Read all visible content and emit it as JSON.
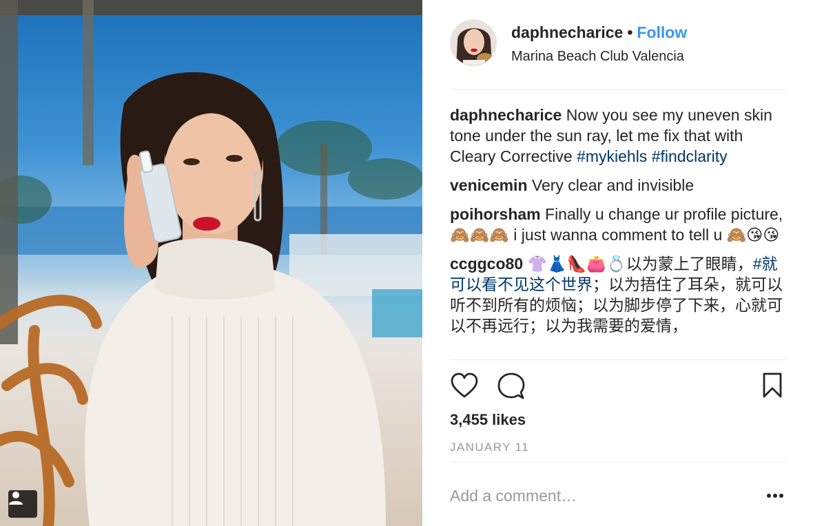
{
  "post": {
    "username": "daphnecharice",
    "follow_label": "Follow",
    "separator": "•",
    "location": "Marina Beach Club Valencia"
  },
  "comments": [
    {
      "user": "daphnecharice",
      "text": "Now you see my uneven skin tone under the sun ray, let me fix that with Cleary Corrective ",
      "tags": [
        "#mykiehls",
        "#findclarity"
      ]
    },
    {
      "user": "venicemin",
      "text": "Very clear and invisible"
    },
    {
      "user": "poihorsham",
      "text": "Finally u change ur profile picture, 🙈🙈🙈 i just wanna comment to tell u 🙈😘😘"
    },
    {
      "user": "ccggco80",
      "text_before": "👚👗👠👛💍以为蒙上了眼睛，",
      "tag": "#就可以看不见这个世界",
      "text_after": "；以为捂住了耳朵，就可以听不到所有的烦恼；以为脚步停了下来，心就可以不再远行；以为我需要的爱情，"
    }
  ],
  "stats": {
    "likes": "3,455 likes",
    "date": "JANUARY 11"
  },
  "add_comment": {
    "placeholder": "Add a comment…"
  },
  "icons": {
    "like": "heart-outline-icon",
    "comment": "speech-bubble-icon",
    "save": "bookmark-icon",
    "more": "ellipsis-icon",
    "user_tag": "person-tag-icon"
  },
  "colors": {
    "accent": "#3897f0",
    "hashtag": "#003569",
    "muted": "#999999",
    "text": "#262626"
  }
}
